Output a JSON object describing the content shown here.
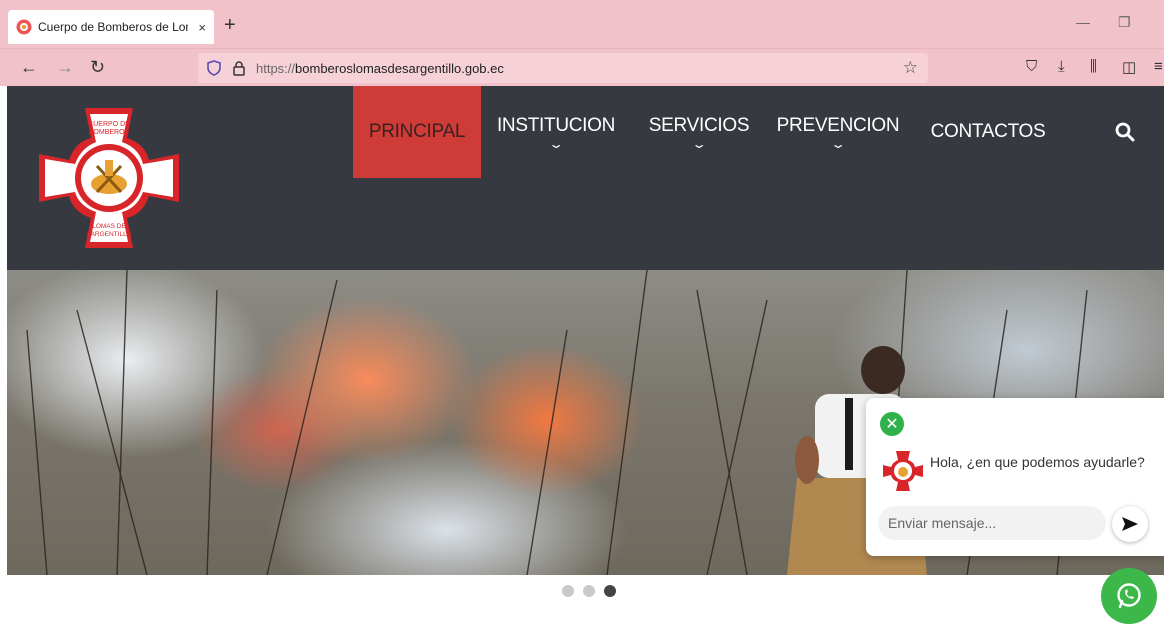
{
  "browser": {
    "tab_title": "Cuerpo de Bomberos de Lomas",
    "tab_close": "×",
    "new_tab": "+",
    "url_protocol": "https://",
    "url_host": "bomberoslomasdesargentillo.gob.ec",
    "window_controls": [
      "—",
      "❐"
    ],
    "nav_icons": [
      "back-icon",
      "forward-icon",
      "reload-icon"
    ],
    "toolbar_icons": [
      "pocket-icon",
      "download-icon",
      "library-icon",
      "sidebar-icon",
      "menu-icon"
    ]
  },
  "site": {
    "logo_text_top": "CUERPO DE BOMBEROS",
    "logo_text_bottom": "LOMAS DE SARGENTILLO",
    "menu": [
      {
        "label": "PRINCIPAL",
        "active": true,
        "has_dropdown": false
      },
      {
        "label": "INSTITUCION",
        "active": false,
        "has_dropdown": true
      },
      {
        "label": "SERVICIOS",
        "active": false,
        "has_dropdown": true
      },
      {
        "label": "PREVENCION",
        "active": false,
        "has_dropdown": true
      },
      {
        "label": "CONTACTOS",
        "active": false,
        "has_dropdown": false
      }
    ],
    "colors": {
      "header_bg": "#36393f",
      "active_menu": "#cf3b37",
      "chrome": "#f2c2cb"
    }
  },
  "slider": {
    "slide_count": 3,
    "active_slide": 3
  },
  "chat": {
    "greeting": "Hola, ¿en que podemos ayudarle?",
    "input_placeholder": "Enviar mensaje..."
  }
}
